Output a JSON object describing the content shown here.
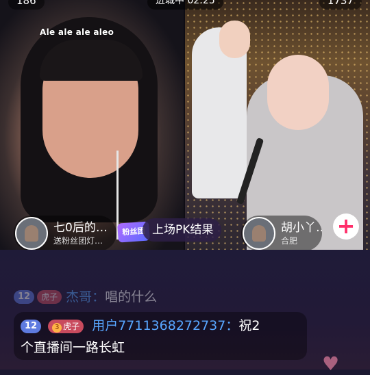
{
  "top": {
    "left_count": "186",
    "center_status": "进城中 02:25",
    "right_count": "1737"
  },
  "left_stream": {
    "song_title": "Ale ale ale aleo",
    "host_name": "七0后的…",
    "host_sub": "送粉丝团灯…",
    "fan_tag": "粉丝团",
    "pk_result": "上场PK结果"
  },
  "right_stream": {
    "host_name": "胡小丫…",
    "host_location": "合肥",
    "add_label": "+"
  },
  "chat": {
    "faded": {
      "level": "12",
      "fan_name": "虎子",
      "user": "杰哥",
      "text": "唱的什么"
    },
    "latest": {
      "level": "12",
      "fan_level": "3",
      "fan_name": "虎子",
      "user": "用户7711368272737",
      "text_line1": "祝2",
      "text_line2": "个直播间一路长虹"
    }
  },
  "colors": {
    "username": "#58a6ff",
    "level_badge": "#5e7be0",
    "fan_badge": "#c94b5e",
    "follow_plus": "#ff2e6a"
  },
  "icons": [
    "heart-icon",
    "plus-icon",
    "avatar-icon"
  ]
}
